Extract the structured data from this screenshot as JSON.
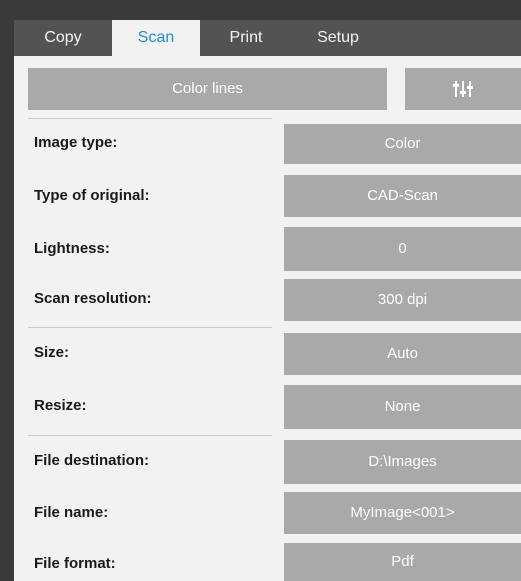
{
  "tabs": [
    {
      "label": "Copy",
      "active": false
    },
    {
      "label": "Scan",
      "active": true
    },
    {
      "label": "Print",
      "active": false
    },
    {
      "label": "Setup",
      "active": false
    }
  ],
  "toolbar": {
    "preset_label": "Color lines",
    "settings_icon": "sliders-icon"
  },
  "settings": [
    {
      "label": "Image type:",
      "value": "Color"
    },
    {
      "label": "Type of original:",
      "value": "CAD-Scan"
    },
    {
      "label": "Lightness:",
      "value": "0"
    },
    {
      "label": "Scan resolution:",
      "value": "300 dpi"
    },
    {
      "label": "Size:",
      "value": "Auto"
    },
    {
      "label": "Resize:",
      "value": "None"
    },
    {
      "label": "File destination:",
      "value": "D:\\Images"
    },
    {
      "label": "File name:",
      "value": "MyImage<001>"
    },
    {
      "label": "File format:",
      "value": "Pdf"
    }
  ],
  "colors": {
    "tab_bar": "#535353",
    "active_tab_text": "#1f8fd3",
    "button_fill": "#a9a9a9",
    "panel_background": "#f2f2f2"
  }
}
